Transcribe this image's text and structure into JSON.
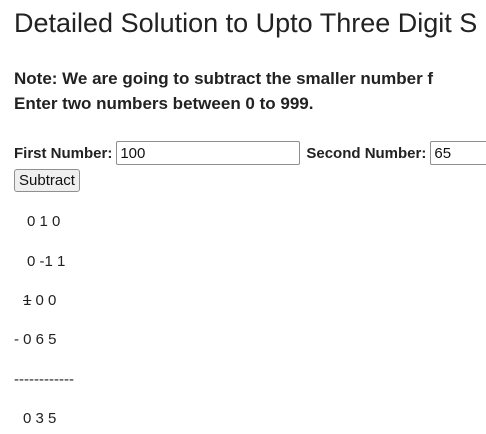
{
  "page": {
    "title": "Detailed Solution to Upto Three Digit S",
    "note_line1": "Note: We are going to subtract the smaller number f",
    "note_line2": "Enter two numbers between 0 to 999."
  },
  "form": {
    "first_label": "First Number:",
    "first_value": "100",
    "second_label": "Second Number:",
    "second_value": "65",
    "button_label": "Subtract"
  },
  "solution": {
    "borrow_row_1": "0 1 0",
    "borrow_row_2": "0 -1 1",
    "minuend_strike": "1",
    "minuend_rest": "0 0",
    "subtrahend_row": "- 0 6 5",
    "divider": "------------",
    "result_row": "0 3 5"
  }
}
